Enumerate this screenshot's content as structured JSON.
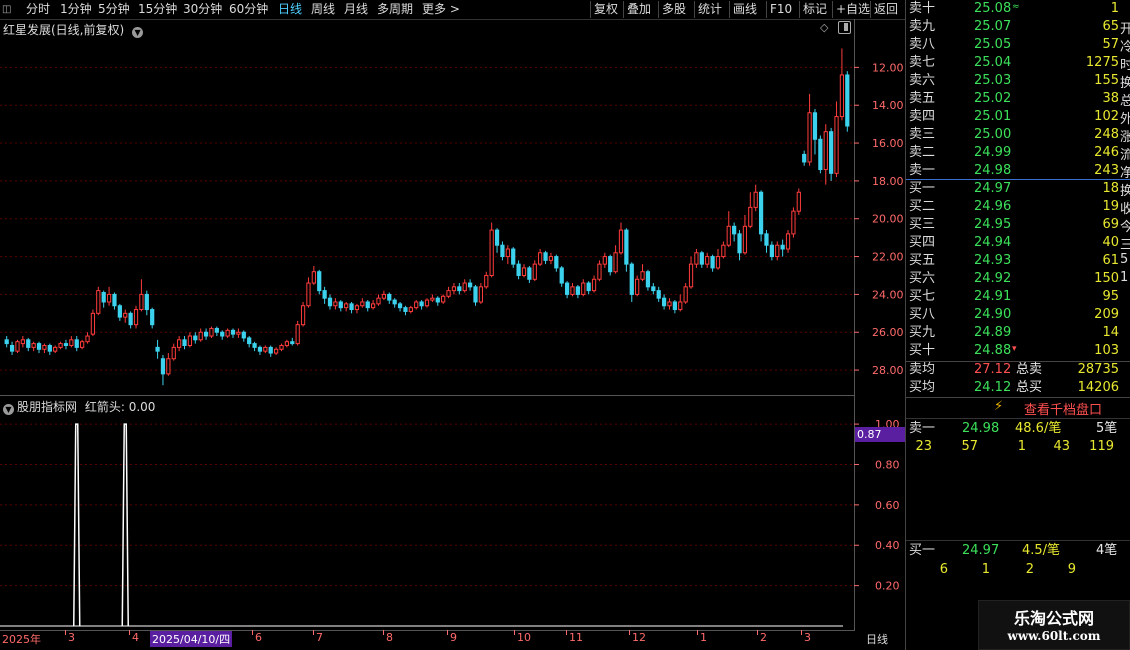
{
  "toolbar": {
    "left_items": [
      "分时",
      "1分钟",
      "5分钟",
      "15分钟",
      "30分钟",
      "60分钟",
      "日线",
      "周线",
      "月线",
      "多周期",
      "更多 >"
    ],
    "active_index": 6,
    "right_items": [
      "复权",
      "叠加",
      "多股",
      "统计",
      "画线",
      "F10",
      "标记",
      "+自选",
      "返回"
    ]
  },
  "main_pane": {
    "title": "红星发展(日线,前复权)",
    "title_icon": "chevron-down-icon",
    "y_ticks": [
      "28.00",
      "26.00",
      "24.00",
      "22.00",
      "20.00",
      "18.00",
      "16.00",
      "14.00",
      "12.00"
    ]
  },
  "indicator_pane": {
    "title": "股朋指标网",
    "series_label": "红箭头: 0.00",
    "y_ticks": [
      "1.00",
      "0.80",
      "0.60",
      "0.40",
      "0.20"
    ],
    "current_value": "0.87"
  },
  "x_axis": {
    "labels": [
      "2025年",
      "3",
      "4",
      "2025/04/10/四",
      "6",
      "7",
      "8",
      "9",
      "10",
      "11",
      "12",
      "1",
      "2",
      "3"
    ],
    "period": "日线"
  },
  "order_book": {
    "asks": [
      {
        "label": "卖十",
        "price": "25.08",
        "vol": "1"
      },
      {
        "label": "卖九",
        "price": "25.07",
        "vol": "65"
      },
      {
        "label": "卖八",
        "price": "25.05",
        "vol": "57"
      },
      {
        "label": "卖七",
        "price": "25.04",
        "vol": "1275"
      },
      {
        "label": "卖六",
        "price": "25.03",
        "vol": "155"
      },
      {
        "label": "卖五",
        "price": "25.02",
        "vol": "38"
      },
      {
        "label": "卖四",
        "price": "25.01",
        "vol": "102"
      },
      {
        "label": "卖三",
        "price": "25.00",
        "vol": "248"
      },
      {
        "label": "卖二",
        "price": "24.99",
        "vol": "246"
      },
      {
        "label": "卖一",
        "price": "24.98",
        "vol": "243"
      }
    ],
    "bids": [
      {
        "label": "买一",
        "price": "24.97",
        "vol": "18"
      },
      {
        "label": "买二",
        "price": "24.96",
        "vol": "19"
      },
      {
        "label": "买三",
        "price": "24.95",
        "vol": "69"
      },
      {
        "label": "买四",
        "price": "24.94",
        "vol": "40"
      },
      {
        "label": "买五",
        "price": "24.93",
        "vol": "61"
      },
      {
        "label": "买六",
        "price": "24.92",
        "vol": "150"
      },
      {
        "label": "买七",
        "price": "24.91",
        "vol": "95"
      },
      {
        "label": "买八",
        "price": "24.90",
        "vol": "209"
      },
      {
        "label": "买九",
        "price": "24.89",
        "vol": "14"
      },
      {
        "label": "买十",
        "price": "24.88",
        "vol": "103"
      }
    ],
    "avg_sell_label": "卖均",
    "avg_sell_price": "27.12",
    "total_sell_label": "总卖",
    "total_sell": "28735",
    "avg_buy_label": "买均",
    "avg_buy_price": "24.12",
    "total_buy_label": "总买",
    "total_buy": "14206"
  },
  "depth_button": "查看千档盘口",
  "queue_sell": {
    "label": "卖一",
    "price": "24.98",
    "per_trade": "48.6/笔",
    "count": "5笔",
    "orders": [
      "23",
      "57",
      "1",
      "43",
      "119"
    ]
  },
  "queue_buy": {
    "label": "买一",
    "price": "24.97",
    "per_trade": "4.5/笔",
    "count": "4笔",
    "orders": [
      "6",
      "1",
      "2",
      "9"
    ]
  },
  "edge_chars": [
    "开",
    "冷",
    "时",
    "换",
    "总",
    "外",
    "涨",
    "流",
    "净",
    "换",
    "收",
    "今",
    "三",
    "5",
    "1"
  ],
  "watermark": {
    "line1": "乐淘公式网",
    "line2": "www.60lt.com"
  },
  "colors": {
    "up": "#ff3c3c",
    "down": "#3cd2ee",
    "ask_green": "#3ce05a",
    "accent": "#4fd0ff",
    "volume": "#e8e830"
  },
  "chart_data": {
    "type": "candlestick",
    "title": "红星发展(日线,前复权)",
    "ylim": [
      11,
      29.5
    ],
    "y_ticks": [
      12,
      14,
      16,
      18,
      20,
      22,
      24,
      26,
      28
    ],
    "indicator": {
      "name": "红箭头",
      "ylim": [
        0,
        1.05
      ],
      "signals_at_index": [
        13,
        22
      ]
    },
    "candles": [
      [
        13.6,
        13.4,
        13.8,
        13.2
      ],
      [
        13.3,
        13.0,
        13.5,
        12.8
      ],
      [
        13.0,
        13.5,
        13.6,
        12.9
      ],
      [
        13.4,
        13.6,
        13.8,
        13.2
      ],
      [
        13.6,
        13.2,
        13.7,
        13.0
      ],
      [
        13.2,
        13.4,
        13.5,
        13.0
      ],
      [
        13.4,
        13.1,
        13.5,
        12.9
      ],
      [
        13.1,
        13.3,
        13.4,
        12.9
      ],
      [
        13.3,
        13.0,
        13.4,
        12.8
      ],
      [
        13.0,
        13.2,
        13.3,
        12.9
      ],
      [
        13.2,
        13.4,
        13.5,
        13.1
      ],
      [
        13.4,
        13.3,
        13.6,
        13.1
      ],
      [
        13.3,
        13.6,
        13.8,
        13.2
      ],
      [
        13.6,
        13.2,
        13.8,
        13.0
      ],
      [
        13.2,
        13.5,
        13.6,
        13.1
      ],
      [
        13.5,
        13.8,
        14.0,
        13.4
      ],
      [
        13.9,
        15.0,
        15.2,
        13.8
      ],
      [
        15.0,
        16.2,
        16.4,
        14.9
      ],
      [
        16.1,
        15.6,
        16.2,
        15.3
      ],
      [
        15.6,
        16.0,
        16.4,
        15.4
      ],
      [
        16.0,
        15.4,
        16.1,
        15.2
      ],
      [
        15.4,
        14.8,
        15.5,
        14.6
      ],
      [
        14.8,
        15.0,
        15.2,
        14.5
      ],
      [
        15.0,
        14.4,
        15.1,
        14.2
      ],
      [
        14.4,
        15.2,
        15.4,
        14.2
      ],
      [
        15.2,
        16.0,
        16.8,
        15.1
      ],
      [
        16.0,
        15.2,
        16.2,
        14.9
      ],
      [
        15.2,
        14.4,
        15.3,
        14.2
      ],
      [
        13.2,
        13.0,
        13.6,
        12.6
      ],
      [
        12.6,
        11.8,
        12.8,
        11.2
      ],
      [
        11.8,
        12.6,
        12.9,
        11.7
      ],
      [
        12.6,
        13.2,
        13.4,
        12.5
      ],
      [
        13.2,
        13.6,
        13.8,
        13.0
      ],
      [
        13.6,
        13.3,
        13.8,
        13.1
      ],
      [
        13.3,
        13.8,
        14.0,
        13.2
      ],
      [
        13.8,
        13.6,
        14.0,
        13.4
      ],
      [
        13.6,
        14.0,
        14.2,
        13.5
      ],
      [
        14.0,
        13.8,
        14.2,
        13.6
      ],
      [
        13.8,
        14.2,
        14.3,
        13.7
      ],
      [
        14.2,
        14.0,
        14.3,
        13.8
      ],
      [
        14.0,
        13.8,
        14.1,
        13.6
      ],
      [
        13.8,
        14.1,
        14.2,
        13.7
      ],
      [
        14.1,
        13.9,
        14.2,
        13.7
      ],
      [
        13.9,
        14.0,
        14.2,
        13.7
      ],
      [
        14.0,
        13.7,
        14.1,
        13.5
      ],
      [
        13.7,
        13.4,
        13.8,
        13.2
      ],
      [
        13.4,
        13.2,
        13.5,
        13.0
      ],
      [
        13.2,
        13.0,
        13.3,
        12.8
      ],
      [
        13.0,
        13.2,
        13.3,
        12.9
      ],
      [
        13.2,
        12.9,
        13.3,
        12.7
      ],
      [
        12.9,
        13.1,
        13.2,
        12.8
      ],
      [
        13.1,
        13.3,
        13.4,
        13.0
      ],
      [
        13.3,
        13.5,
        13.6,
        13.2
      ],
      [
        13.5,
        13.4,
        13.7,
        13.3
      ],
      [
        13.4,
        14.4,
        14.6,
        13.3
      ],
      [
        14.4,
        15.4,
        15.6,
        14.3
      ],
      [
        15.4,
        16.6,
        16.9,
        15.3
      ],
      [
        16.6,
        17.2,
        17.5,
        16.5
      ],
      [
        17.2,
        16.2,
        17.3,
        16.0
      ],
      [
        16.2,
        15.8,
        16.4,
        15.5
      ],
      [
        15.8,
        15.4,
        16.0,
        15.2
      ],
      [
        15.4,
        15.6,
        15.8,
        15.2
      ],
      [
        15.6,
        15.3,
        15.7,
        15.1
      ],
      [
        15.3,
        15.5,
        15.6,
        15.1
      ],
      [
        15.5,
        15.2,
        15.6,
        15.0
      ],
      [
        15.2,
        15.4,
        15.5,
        15.0
      ],
      [
        15.4,
        15.6,
        15.8,
        15.3
      ],
      [
        15.6,
        15.3,
        15.7,
        15.1
      ],
      [
        15.3,
        15.5,
        15.7,
        15.2
      ],
      [
        15.5,
        15.8,
        16.0,
        15.4
      ],
      [
        15.8,
        16.0,
        16.2,
        15.7
      ],
      [
        16.0,
        15.7,
        16.1,
        15.5
      ],
      [
        15.7,
        15.5,
        15.8,
        15.3
      ],
      [
        15.5,
        15.3,
        15.6,
        15.1
      ],
      [
        15.3,
        15.1,
        15.4,
        14.9
      ],
      [
        15.1,
        15.3,
        15.4,
        15.0
      ],
      [
        15.3,
        15.6,
        15.7,
        15.2
      ],
      [
        15.6,
        15.4,
        15.7,
        15.2
      ],
      [
        15.4,
        15.7,
        15.8,
        15.3
      ],
      [
        15.7,
        15.8,
        16.0,
        15.6
      ],
      [
        15.8,
        15.6,
        15.9,
        15.4
      ],
      [
        15.6,
        15.9,
        16.0,
        15.5
      ],
      [
        15.9,
        16.2,
        16.4,
        15.8
      ],
      [
        16.2,
        16.4,
        16.6,
        16.0
      ],
      [
        16.4,
        16.2,
        16.6,
        16.0
      ],
      [
        16.2,
        16.6,
        16.8,
        16.1
      ],
      [
        16.6,
        16.4,
        16.8,
        16.2
      ],
      [
        16.4,
        15.6,
        16.5,
        15.4
      ],
      [
        15.6,
        16.4,
        16.6,
        15.5
      ],
      [
        16.4,
        17.0,
        17.2,
        16.3
      ],
      [
        17.0,
        19.4,
        19.8,
        16.9
      ],
      [
        19.4,
        18.6,
        19.5,
        18.2
      ],
      [
        18.6,
        18.0,
        18.8,
        17.8
      ],
      [
        18.0,
        18.4,
        18.6,
        17.6
      ],
      [
        18.4,
        17.6,
        18.5,
        17.4
      ],
      [
        17.6,
        17.0,
        17.8,
        16.8
      ],
      [
        17.0,
        17.4,
        17.6,
        16.9
      ],
      [
        17.4,
        16.8,
        17.5,
        16.6
      ],
      [
        16.8,
        17.6,
        17.8,
        16.7
      ],
      [
        17.6,
        18.2,
        18.4,
        17.5
      ],
      [
        18.2,
        17.8,
        18.3,
        17.6
      ],
      [
        17.8,
        18.0,
        18.2,
        17.6
      ],
      [
        18.0,
        17.4,
        18.1,
        17.2
      ],
      [
        17.4,
        16.6,
        17.5,
        16.4
      ],
      [
        16.6,
        16.0,
        16.7,
        15.8
      ],
      [
        16.0,
        16.4,
        16.6,
        15.9
      ],
      [
        16.4,
        16.0,
        16.5,
        15.8
      ],
      [
        16.0,
        16.6,
        16.8,
        15.9
      ],
      [
        16.6,
        16.2,
        16.7,
        16.0
      ],
      [
        16.2,
        16.8,
        17.0,
        16.1
      ],
      [
        16.8,
        17.6,
        17.8,
        16.7
      ],
      [
        17.6,
        18.0,
        18.2,
        17.4
      ],
      [
        18.0,
        17.2,
        18.1,
        17.0
      ],
      [
        17.2,
        18.2,
        18.6,
        17.1
      ],
      [
        18.2,
        19.4,
        19.8,
        18.1
      ],
      [
        19.4,
        17.6,
        19.5,
        17.2
      ],
      [
        17.6,
        16.0,
        17.7,
        15.6
      ],
      [
        16.0,
        16.8,
        17.0,
        15.9
      ],
      [
        16.8,
        17.2,
        17.6,
        16.7
      ],
      [
        17.2,
        16.4,
        17.3,
        16.2
      ],
      [
        16.4,
        16.2,
        16.6,
        16.0
      ],
      [
        16.2,
        15.8,
        16.4,
        15.6
      ],
      [
        15.8,
        15.4,
        16.0,
        15.2
      ],
      [
        15.4,
        15.6,
        15.8,
        15.2
      ],
      [
        15.6,
        15.2,
        15.7,
        15.0
      ],
      [
        15.2,
        15.6,
        16.0,
        15.1
      ],
      [
        15.6,
        16.4,
        16.6,
        15.5
      ],
      [
        16.4,
        17.6,
        18.0,
        16.3
      ],
      [
        17.6,
        18.2,
        18.4,
        17.4
      ],
      [
        18.2,
        17.6,
        18.3,
        17.4
      ],
      [
        17.6,
        18.0,
        18.2,
        17.4
      ],
      [
        18.0,
        17.4,
        18.1,
        17.2
      ],
      [
        17.4,
        18.0,
        18.4,
        17.3
      ],
      [
        18.0,
        18.6,
        18.8,
        17.9
      ],
      [
        18.6,
        19.6,
        20.4,
        18.5
      ],
      [
        19.6,
        19.2,
        19.8,
        18.8
      ],
      [
        19.2,
        18.2,
        19.4,
        17.8
      ],
      [
        18.2,
        19.6,
        20.2,
        18.1
      ],
      [
        19.6,
        20.6,
        21.4,
        19.5
      ],
      [
        20.6,
        21.4,
        21.8,
        20.4
      ],
      [
        21.4,
        19.2,
        21.5,
        18.8
      ],
      [
        19.2,
        18.6,
        19.4,
        18.2
      ],
      [
        18.6,
        18.0,
        18.8,
        17.8
      ],
      [
        18.0,
        18.6,
        18.8,
        17.8
      ],
      [
        18.6,
        18.4,
        18.9,
        18.0
      ],
      [
        18.4,
        19.2,
        19.4,
        18.2
      ],
      [
        19.2,
        20.4,
        20.6,
        19.0
      ],
      [
        20.4,
        21.4,
        21.6,
        20.2
      ],
      [
        23.4,
        23.0,
        23.6,
        22.8
      ],
      [
        23.0,
        25.6,
        26.6,
        22.8
      ],
      [
        25.6,
        24.2,
        25.8,
        23.4
      ],
      [
        24.2,
        22.6,
        24.4,
        22.4
      ],
      [
        22.6,
        24.6,
        25.0,
        21.8
      ],
      [
        24.6,
        22.4,
        24.8,
        22.0
      ],
      [
        22.4,
        25.4,
        26.2,
        22.2
      ],
      [
        25.4,
        27.6,
        29.0,
        25.2
      ],
      [
        27.6,
        24.9,
        27.8,
        24.6
      ]
    ]
  }
}
